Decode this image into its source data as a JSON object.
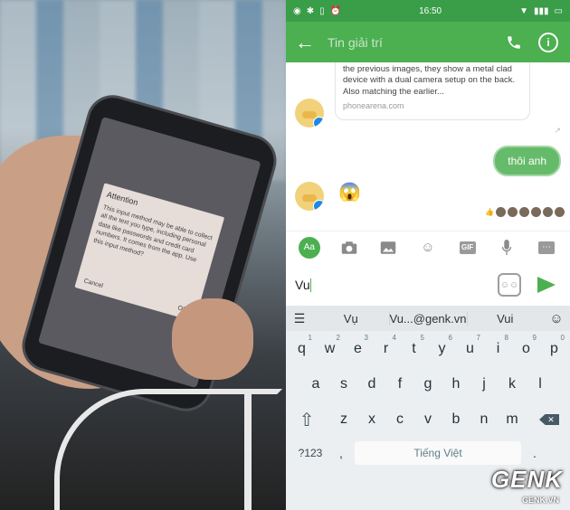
{
  "photo": {
    "dialog_title": "Attention",
    "dialog_body": "This input method may be able to collect all the text you type, including personal data like passwords and credit card numbers. It comes from the app. Use this input method?",
    "dialog_cancel": "Cancel",
    "dialog_ok": "OK"
  },
  "statusbar": {
    "time": "16:50"
  },
  "topbar": {
    "title": "Tin giải trí"
  },
  "chat": {
    "card_text": "the previous images, they show a metal clad device with a dual camera setup on the back. Also matching the earlier...",
    "card_source": "phonearena.com",
    "bubble": "thôi anh",
    "emoji": "😱",
    "forward": "↗"
  },
  "compose": {
    "aa": "Aa",
    "gif": "GIF",
    "more": "⋯",
    "input_value": "Vu"
  },
  "keyboard": {
    "suggestions": [
      "Vụ",
      "Vu...@genk.vn",
      "Vui"
    ],
    "row1": [
      [
        "q",
        "1"
      ],
      [
        "w",
        "2"
      ],
      [
        "e",
        "3"
      ],
      [
        "r",
        "4"
      ],
      [
        "t",
        "5"
      ],
      [
        "y",
        "6"
      ],
      [
        "u",
        "7"
      ],
      [
        "i",
        "8"
      ],
      [
        "o",
        "9"
      ],
      [
        "p",
        "0"
      ]
    ],
    "row2": [
      "a",
      "s",
      "d",
      "f",
      "g",
      "h",
      "j",
      "k",
      "l"
    ],
    "row3": [
      "z",
      "x",
      "c",
      "v",
      "b",
      "n",
      "m"
    ],
    "symbols": "?123",
    "comma": ",",
    "space_label": "Tiếng Việt",
    "period": "."
  },
  "watermark": {
    "brand": "GENK",
    "domain": "GENK.VN"
  },
  "colors": {
    "accent": "#4caf50",
    "status": "#3a9d47"
  }
}
